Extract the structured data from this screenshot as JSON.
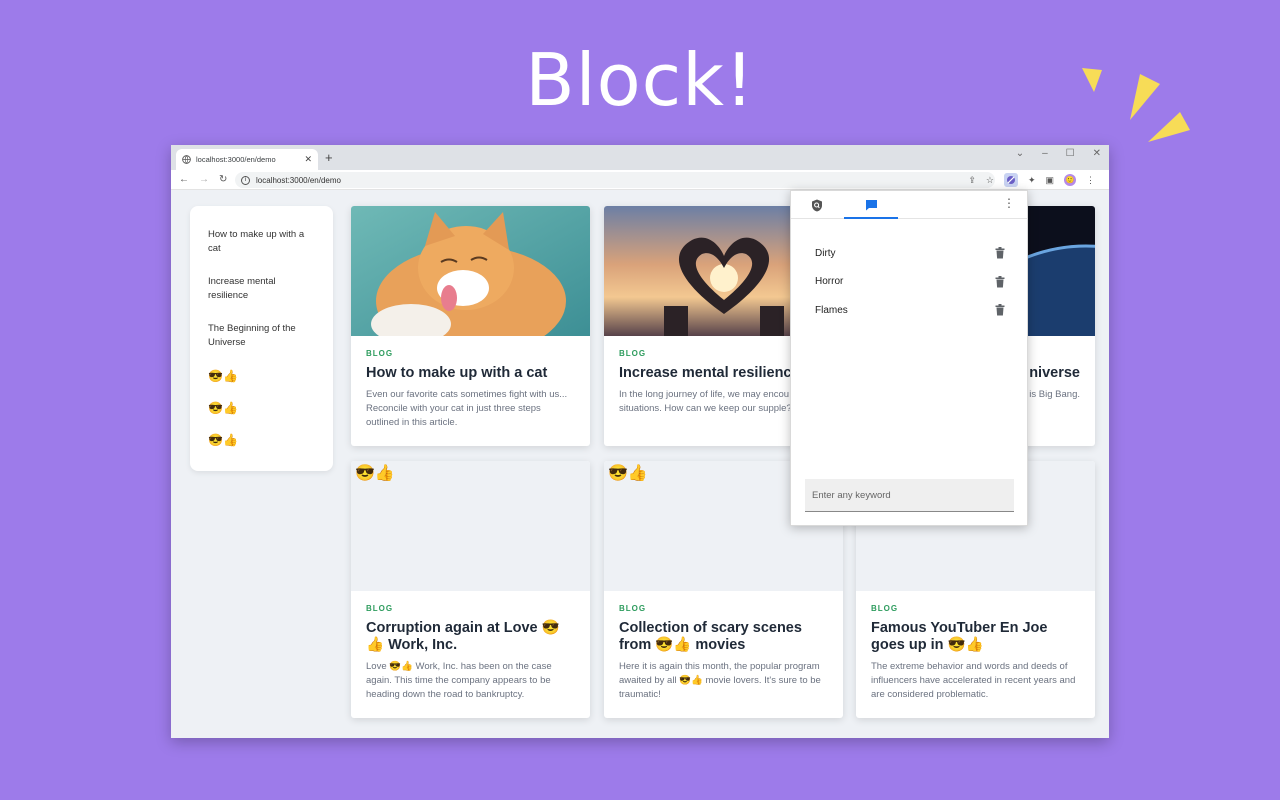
{
  "hero": {
    "title": "Block!"
  },
  "browser": {
    "tab_title": "localhost:3000/en/demo",
    "new_tab": "+",
    "url": "localhost:3000/en/demo"
  },
  "sidebar": {
    "items": [
      "How to make up with a cat",
      "Increase mental resilience",
      "The Beginning of the Universe"
    ],
    "emoji_items": [
      "😎👍",
      "😎👍",
      "😎👍"
    ]
  },
  "cards": [
    {
      "category": "BLOG",
      "title": "How to make up with a cat",
      "description": "Even our favorite cats sometimes fight with us... Reconcile with your cat in just three steps outlined in this article.",
      "image": "cat-photo"
    },
    {
      "category": "BLOG",
      "title": "Increase mental resilience",
      "description": "In the long journey of life, we may encou difficult situations. How can we keep our supple?",
      "image": "heart-hands-photo"
    },
    {
      "category": "BLOG",
      "title": "niverse",
      "description": "e universe is Big Bang.",
      "image": "earth-space-photo"
    },
    {
      "category": "BLOG",
      "title": "Corruption again at Love 😎👍 Work, Inc.",
      "description": "Love 😎👍 Work, Inc. has been on the case again. This time the company appears to be heading down the road to bankruptcy.",
      "placeholder": "😎👍"
    },
    {
      "category": "BLOG",
      "title": "Collection of scary scenes from 😎👍 movies",
      "description": "Here it is again this month, the popular program awaited by all 😎👍 movie lovers. It's sure to be traumatic!",
      "placeholder": "😎👍"
    },
    {
      "category": "BLOG",
      "title": "Famous YouTuber En Joe goes up in 😎👍",
      "description": "The extreme behavior and words and deeds of influencers have accelerated in recent years and are considered problematic.",
      "placeholder": ""
    }
  ],
  "popup": {
    "keywords": [
      "Dirty",
      "Horror",
      "Flames"
    ],
    "input_placeholder": "Enter any keyword"
  },
  "colors": {
    "background": "#9d7bea",
    "accent": "#1a73e8",
    "category": "#2e9c5e",
    "burst": "#f7dc57"
  }
}
